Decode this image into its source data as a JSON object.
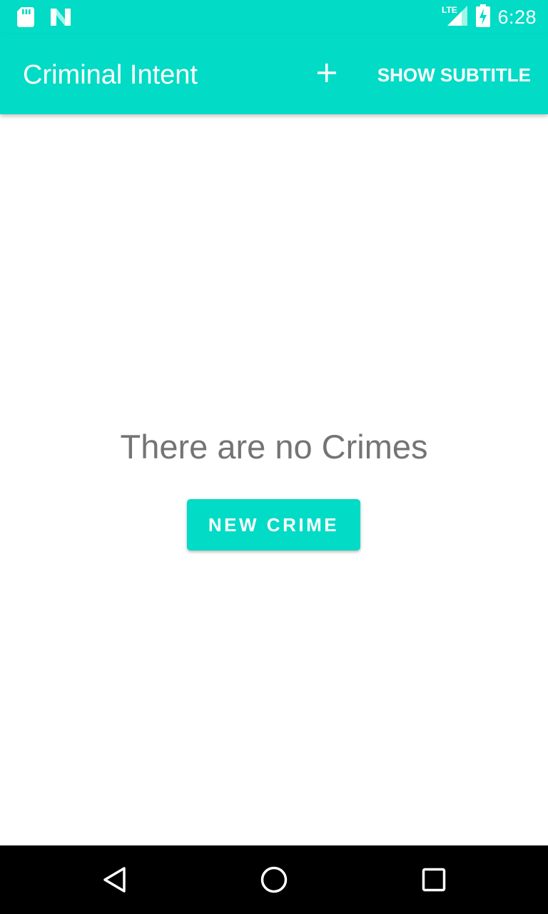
{
  "status_bar": {
    "time": "6:28",
    "network_label": "LTE",
    "icons": [
      "sd-card-icon",
      "n-notification-icon",
      "lte-signal-icon",
      "battery-charging-icon"
    ]
  },
  "app_bar": {
    "title": "Criminal Intent",
    "add_icon": "plus-icon",
    "show_subtitle_label": "SHOW SUBTITLE"
  },
  "main": {
    "empty_message": "There are no Crimes",
    "new_crime_label": "NEW CRIME"
  },
  "nav_bar": {
    "icons": [
      "back-icon",
      "home-icon",
      "recents-icon"
    ]
  },
  "colors": {
    "accent": "#02DBC5",
    "empty_text": "#747474",
    "nav_background": "#000000"
  }
}
